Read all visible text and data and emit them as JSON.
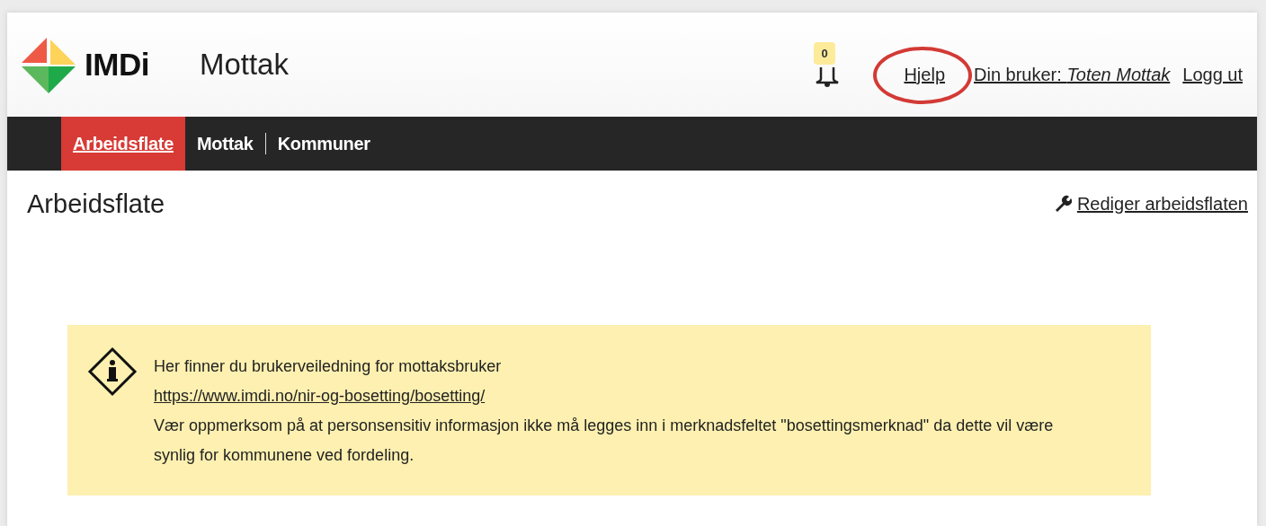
{
  "header": {
    "logo_text": "IMDi",
    "app_title": "Mottak",
    "notifications": {
      "count": "0"
    },
    "links": [
      {
        "kind": "help",
        "label": "Hjelp",
        "circled": true
      },
      {
        "kind": "user",
        "label": "Din bruker: *Toten Mottak*",
        "circled": false
      },
      {
        "kind": "logout",
        "label": "Logg ut",
        "circled": false
      }
    ]
  },
  "nav": {
    "items": [
      {
        "label": "Arbeidsflate",
        "selected": true
      },
      {
        "label": "Mottak",
        "selected": false
      },
      {
        "label": "Kommuner",
        "selected": false
      }
    ]
  },
  "page": {
    "title": "Arbeidsflate",
    "edit_link": "Rediger arbeidsflaten"
  },
  "notice": {
    "intro": "Her finner du brukerveiledning for mottaksbruker",
    "link": "https://www.imdi.no/nir-og-bosetting/bosetting/",
    "warning": "Vær oppmerksom på at personsensitiv informasjon ikke må legges inn i merknadsfeltet \"bosettingsmerknad\" da dette vil være synlig for kommunene ved fordeling."
  }
}
